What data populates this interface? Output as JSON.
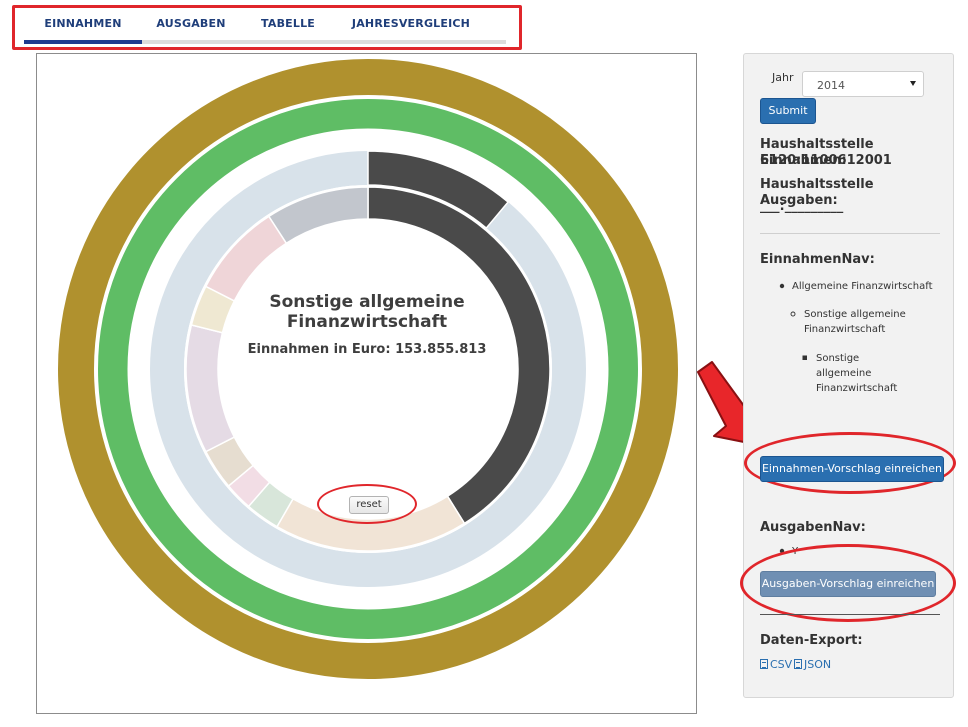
{
  "tabs": [
    {
      "label": "EINNAHMEN",
      "active": true
    },
    {
      "label": "AUSGABEN",
      "active": false
    },
    {
      "label": "TABELLE",
      "active": false
    },
    {
      "label": "JAHRESVERGLEICH",
      "active": false
    }
  ],
  "chart": {
    "title_line1": "Sonstige allgemeine",
    "title_line2": "Finanzwirtschaft",
    "value_label": "Einnahmen in Euro: 153.855.813",
    "reset_label": "reset"
  },
  "sidebar": {
    "year_label": "Jahr",
    "year_selected": "2014",
    "submit_label": "Submit",
    "haushalt_einnahmen_label": "Haushaltsstelle Einnahmen:",
    "haushalt_einnahmen_value": "6120:1100612001",
    "haushalt_ausgaben_label": "Haushaltsstelle Ausgaben:",
    "haushalt_ausgaben_value": "___:_________",
    "einnahmen_nav_title": "EinnahmenNav:",
    "nav_level1": "Allgemeine Finanzwirtschaft",
    "nav_level2_line1": "Sonstige allgemeine",
    "nav_level2_line2": "Finanzwirtschaft",
    "nav_level3_line1": "Sonstige",
    "nav_level3_line2": "allgemeine",
    "nav_level3_line3": "Finanzwirtschaft",
    "einnahmen_button": "Einnahmen-Vorschlag einreichen",
    "ausgaben_nav_title": "AusgabenNav:",
    "ausgaben_nav_item": "Y",
    "ausgaben_button": "Ausgaben-Vorschlag einreichen",
    "export_title": "Daten-Export:",
    "export_csv": "CSV",
    "export_json": "JSON"
  },
  "colors": {
    "accent_blue": "#2a6fb0",
    "outer_ring": "#b0912e",
    "green_ring": "#5fbd65",
    "dark_segment": "#4a4a4a",
    "highlight_red": "#e0262b"
  }
}
